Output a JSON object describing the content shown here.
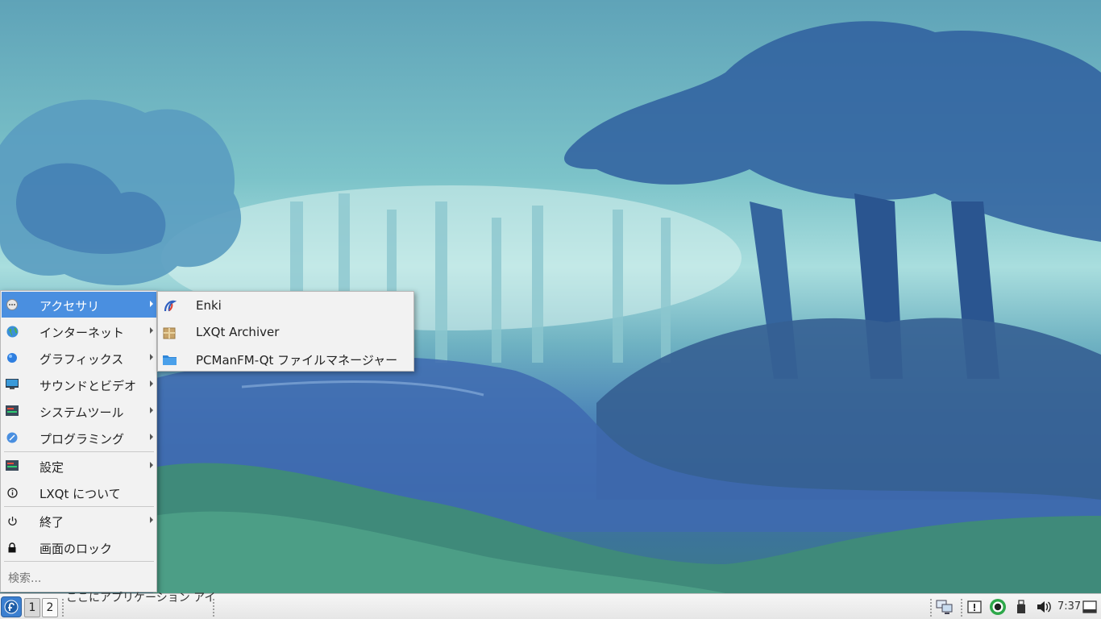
{
  "main_menu": {
    "items": [
      {
        "label": "アクセサリ",
        "icon": "accessories-icon",
        "submenu": true,
        "active": true
      },
      {
        "label": "インターネット",
        "icon": "internet-icon",
        "submenu": true
      },
      {
        "label": "グラフィックス",
        "icon": "graphics-icon",
        "submenu": true
      },
      {
        "label": "サウンドとビデオ",
        "icon": "multimedia-icon",
        "submenu": true
      },
      {
        "label": "システムツール",
        "icon": "system-tools-icon",
        "submenu": true
      },
      {
        "label": "プログラミング",
        "icon": "programming-icon",
        "submenu": true
      },
      {
        "label": "設定",
        "icon": "settings-icon",
        "submenu": true
      },
      {
        "label": "LXQt について",
        "icon": "info-icon",
        "submenu": false
      },
      {
        "label": "終了",
        "icon": "power-icon",
        "submenu": true
      },
      {
        "label": "画面のロック",
        "icon": "lock-icon",
        "submenu": false
      }
    ],
    "search_placeholder": "検索..."
  },
  "sub_menu": {
    "items": [
      {
        "label": "Enki",
        "icon": "enki-icon"
      },
      {
        "label": "LXQt Archiver",
        "icon": "archiver-icon"
      },
      {
        "label": "PCManFM-Qt ファイルマネージャー",
        "icon": "folder-icon"
      }
    ]
  },
  "taskbar": {
    "desktops": [
      "1",
      "2"
    ],
    "quicklaunch_hint": "ここにアプリケーション アイコンをドロップします",
    "clock": "7:37",
    "tray_icons": [
      "network-icon",
      "notification-icon",
      "power-manager-icon",
      "usb-icon",
      "volume-icon",
      "show-desktop-icon"
    ]
  },
  "colors": {
    "accent": "#4a8fe0",
    "menu_bg": "#f2f2f2"
  }
}
